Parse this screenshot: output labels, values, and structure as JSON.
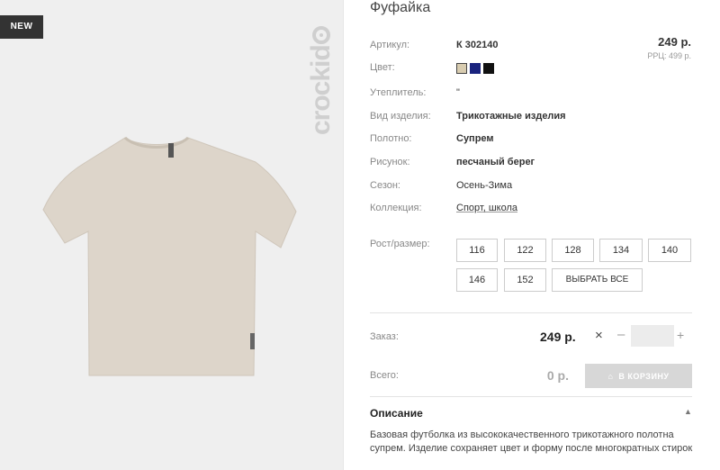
{
  "badge": "NEW",
  "brand": {
    "text_pre": "crockid",
    "text_post": ""
  },
  "product": {
    "title": "Фуфайка",
    "price": "249 р.",
    "rrp": "РРЦ: 499 р."
  },
  "specs": [
    {
      "label": "Артикул:",
      "value": "К 302140"
    },
    {
      "label": "Цвет:",
      "value": ""
    },
    {
      "label": "Утеплитель:",
      "value": "\""
    },
    {
      "label": "Вид изделия:",
      "value": "Трикотажные изделия"
    },
    {
      "label": "Полотно:",
      "value": "Супрем"
    },
    {
      "label": "Рисунок:",
      "value": "песчаный берег"
    },
    {
      "label": "Сезон:",
      "value": "Осень-Зима"
    },
    {
      "label": "Коллекция:",
      "value": "Спорт, школа"
    }
  ],
  "colors": [
    "#d8ccb0",
    "#1a237e",
    "#111111"
  ],
  "sizes": {
    "label": "Рост/размер:",
    "options": [
      "116",
      "122",
      "128",
      "134",
      "140",
      "146",
      "152"
    ],
    "select_all": "ВЫБРАТЬ ВСЕ"
  },
  "order": {
    "label": "Заказ:",
    "price": "249 р.",
    "multiply": "×",
    "minus": "–",
    "quantity": "",
    "plus": "+"
  },
  "total": {
    "label": "Всего:",
    "value": "0 р.",
    "cart_button": "В КОРЗИНУ"
  },
  "description": {
    "title": "Описание",
    "text": "Базовая футболка из высококачественного трикотажного полотна супрем. Изделие сохраняет цвет и форму после многократных стирок"
  }
}
